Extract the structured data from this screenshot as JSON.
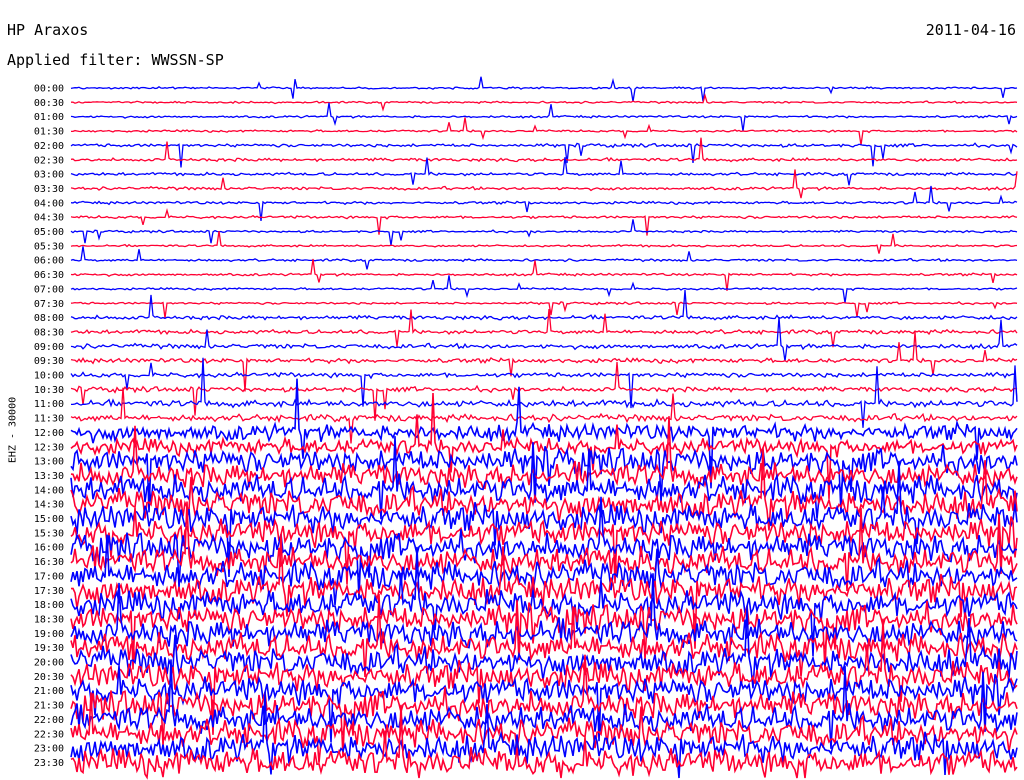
{
  "header": {
    "station": "HP Araxos",
    "date": "2011-04-16",
    "filter": "Applied filter: WWSSN-SP"
  },
  "chart_data": {
    "type": "helicorder",
    "title": "HP Araxos",
    "date": "2011-04-16",
    "filter": "WWSSN-SP",
    "ylabel": "EHZ - 30000",
    "time_labels": [
      "00:00",
      "00:30",
      "01:00",
      "01:30",
      "02:00",
      "02:30",
      "03:00",
      "03:30",
      "04:00",
      "04:30",
      "05:00",
      "05:30",
      "06:00",
      "06:30",
      "07:00",
      "07:30",
      "08:00",
      "08:30",
      "09:00",
      "09:30",
      "10:00",
      "10:30",
      "11:00",
      "11:30",
      "12:00",
      "12:30",
      "13:00",
      "13:30",
      "14:00",
      "14:30",
      "15:00",
      "15:30",
      "16:00",
      "16:30",
      "17:00",
      "17:30",
      "18:00",
      "18:30",
      "19:00",
      "19:30",
      "20:00",
      "20:30",
      "21:00",
      "21:30",
      "22:00",
      "22:30",
      "23:00",
      "23:30"
    ],
    "trace_colors": [
      "#0000ff",
      "#ff0033"
    ],
    "lines_per_hour": 2,
    "relative_amplitude_by_hour": [
      0.7,
      0.8,
      1.2,
      1.1,
      1.0,
      0.8,
      0.9,
      0.8,
      1.5,
      1.7,
      1.8,
      2.5,
      6,
      9,
      10,
      10,
      10,
      10,
      10,
      10,
      10,
      10,
      10,
      10
    ]
  }
}
